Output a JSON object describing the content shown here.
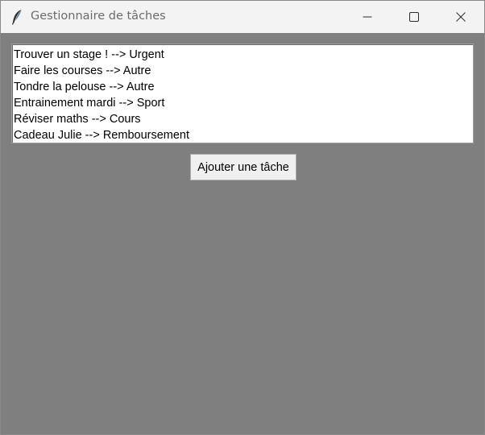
{
  "window": {
    "title": "Gestionnaire de tâches",
    "app_icon": "feather-icon",
    "controls": [
      "minimize-icon",
      "maximize-icon",
      "close-icon"
    ]
  },
  "task_list": {
    "items": [
      "Trouver un stage ! --> Urgent",
      "Faire les courses --> Autre",
      "Tondre la pelouse --> Autre",
      "Entrainement mardi --> Sport",
      "Réviser maths --> Cours",
      "Cadeau Julie --> Remboursement"
    ]
  },
  "actions": {
    "add_task_label": "Ajouter une tâche"
  },
  "colors": {
    "client_background": "#7f7f7f",
    "titlebar_background": "#f3f3f3",
    "list_background": "#ffffff"
  }
}
